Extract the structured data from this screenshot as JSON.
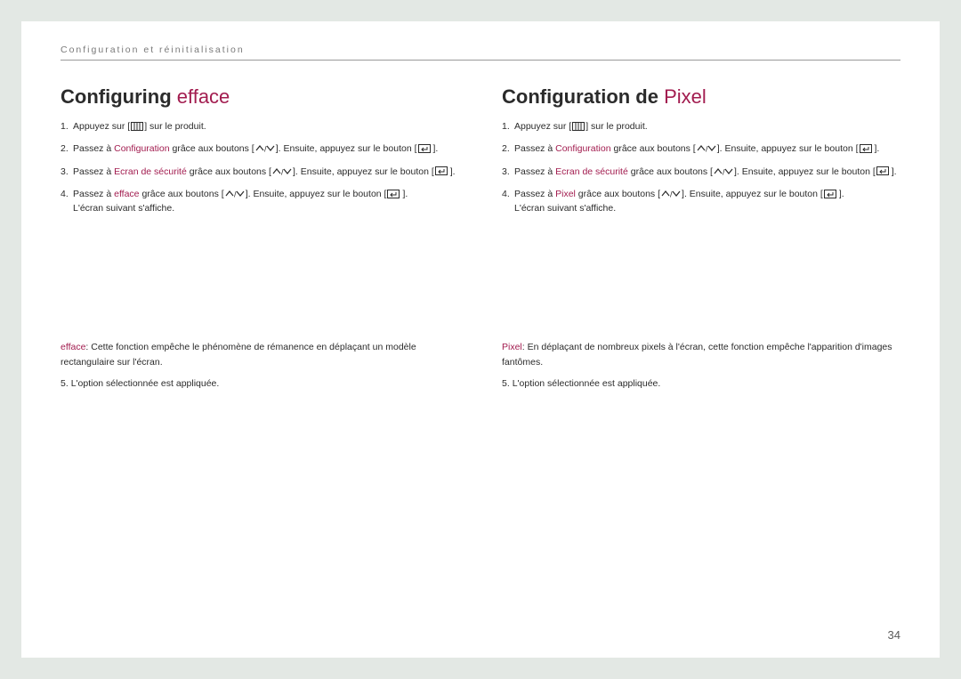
{
  "header": "Configuration et réinitialisation",
  "page_number": "34",
  "left": {
    "title_main": "Configuring ",
    "title_accent": "efface",
    "steps": [
      {
        "n": "1.",
        "pre": "Appuyez sur [",
        "post": "] sur le produit.",
        "icon": "menu"
      },
      {
        "n": "2.",
        "pre": "Passez à ",
        "accent": "Configuration",
        "mid": " grâce aux boutons [",
        "post": "]. Ensuite, appuyez sur le bouton [",
        "post2": "].",
        "icon": "updown",
        "icon2": "enter"
      },
      {
        "n": "3.",
        "pre": "Passez à ",
        "accent": "Ecran de sécurité",
        "mid": " grâce aux boutons [",
        "post": "]. Ensuite, appuyez sur le bouton [",
        "post2": "].",
        "icon": "updown",
        "icon2": "enter"
      },
      {
        "n": "4.",
        "pre": "Passez à ",
        "accent": "efface",
        "mid": " grâce aux boutons [",
        "post": "]. Ensuite, appuyez sur le bouton [",
        "post2": "].",
        "icon": "updown",
        "icon2": "enter",
        "tail": "L'écran suivant s'affiche."
      }
    ],
    "desc_accent": "efface",
    "desc_body": ": Cette fonction empêche le phénomène de rémanence en déplaçant un modèle rectangulaire sur l'écran.",
    "step5_n": "5.",
    "step5": "L'option sélectionnée est appliquée."
  },
  "right": {
    "title_main": "Configuration de ",
    "title_accent": "Pixel",
    "steps": [
      {
        "n": "1.",
        "pre": "Appuyez sur [",
        "post": "] sur le produit.",
        "icon": "menu"
      },
      {
        "n": "2.",
        "pre": "Passez à ",
        "accent": "Configuration",
        "mid": " grâce aux boutons [",
        "post": "]. Ensuite, appuyez sur le bouton [",
        "post2": "].",
        "icon": "updown",
        "icon2": "enter"
      },
      {
        "n": "3.",
        "pre": "Passez à ",
        "accent": "Ecran de sécurité",
        "mid": " grâce aux boutons [",
        "post": "]. Ensuite, appuyez sur le bouton [",
        "post2": "].",
        "icon": "updown",
        "icon2": "enter"
      },
      {
        "n": "4.",
        "pre": "Passez à ",
        "accent": "Pixel",
        "mid": " grâce aux boutons [",
        "post": "]. Ensuite, appuyez sur le bouton [",
        "post2": "].",
        "icon": "updown",
        "icon2": "enter",
        "tail": "L'écran suivant s'affiche."
      }
    ],
    "desc_accent": "Pixel",
    "desc_body": ": En déplaçant de nombreux pixels à l'écran, cette fonction empêche l'apparition d'images fantômes.",
    "step5_n": "5.",
    "step5": "L'option sélectionnée est appliquée."
  }
}
